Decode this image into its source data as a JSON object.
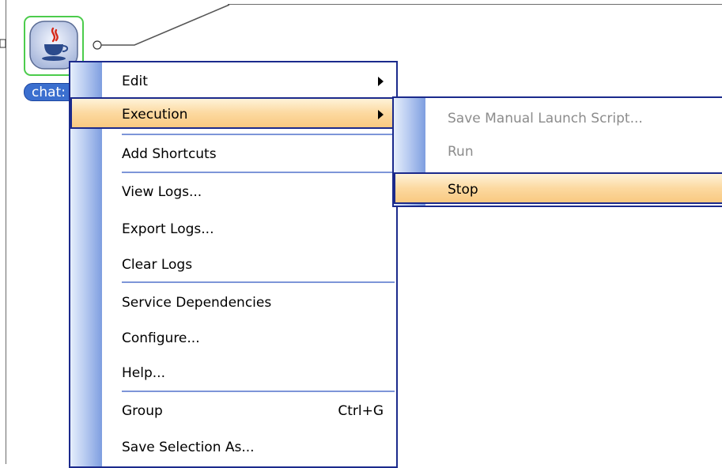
{
  "node": {
    "label": "chat:",
    "icon": "java-cup-icon"
  },
  "context_menu": {
    "items": {
      "edit": "Edit",
      "execution": "Execution",
      "add_shortcuts": "Add Shortcuts",
      "view_logs": "View Logs...",
      "export_logs": "Export Logs...",
      "clear_logs": "Clear Logs",
      "service_dependencies": "Service Dependencies",
      "configure": "Configure...",
      "help": "Help...",
      "group": "Group",
      "group_shortcut": "Ctrl+G",
      "save_selection": "Save Selection As..."
    }
  },
  "execution_submenu": {
    "items": {
      "save_manual_launch": "Save Manual Launch Script...",
      "run": "Run",
      "stop": "Stop"
    }
  },
  "colors": {
    "selection": "#fcd9a0",
    "menu_border": "#1b2a8c",
    "node_frame": "#4ccc4c",
    "label_bg": "#3b6fcf"
  }
}
